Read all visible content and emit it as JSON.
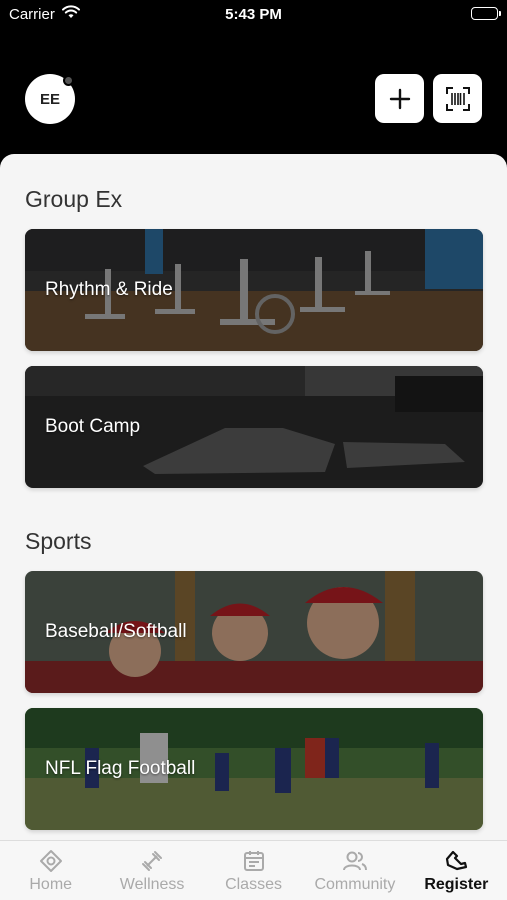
{
  "status_bar": {
    "carrier": "Carrier",
    "time": "5:43 PM"
  },
  "header": {
    "avatar_initials": "EE",
    "add_icon": "plus-icon",
    "scan_icon": "barcode-scan-icon"
  },
  "sections": [
    {
      "title": "Group Ex",
      "cards": [
        {
          "label": "Rhythm & Ride"
        },
        {
          "label": "Boot Camp"
        }
      ]
    },
    {
      "title": "Sports",
      "cards": [
        {
          "label": "Baseball/Softball"
        },
        {
          "label": "NFL Flag Football"
        }
      ]
    }
  ],
  "tab_bar": {
    "items": [
      {
        "label": "Home",
        "icon": "home-icon"
      },
      {
        "label": "Wellness",
        "icon": "dumbbell-icon"
      },
      {
        "label": "Classes",
        "icon": "calendar-icon"
      },
      {
        "label": "Community",
        "icon": "people-icon"
      },
      {
        "label": "Register",
        "icon": "register-icon"
      }
    ],
    "active": "Register"
  }
}
